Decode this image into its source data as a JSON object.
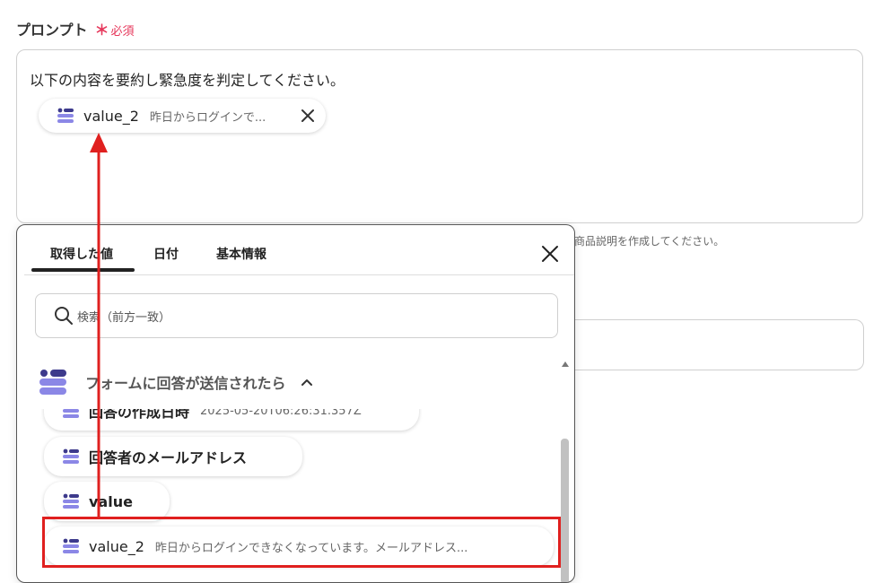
{
  "field": {
    "label": "プロンプト",
    "required_mark": "＊",
    "required_text": "必須"
  },
  "prompt": {
    "text": "以下の内容を要約し緊急度を判定してください。",
    "chip": {
      "name": "value_2",
      "value": "昨日からログインで..."
    }
  },
  "helper_text": "商品説明を作成してください。",
  "popup": {
    "tabs": [
      {
        "label": "取得した値",
        "active": true
      },
      {
        "label": "日付"
      },
      {
        "label": "基本情報"
      }
    ],
    "search": {
      "placeholder": "検索（前方一致）"
    },
    "group": {
      "title": "フォームに回答が送信されたら"
    },
    "items": [
      {
        "name": "回答の作成日時",
        "value": "2025-05-20T06:26:31.357Z"
      },
      {
        "name": "回答者のメールアドレス",
        "value": ""
      },
      {
        "name": "value",
        "value": ""
      },
      {
        "name": "value_2",
        "value": "昨日からログインできなくなっています。メールアドレス..."
      }
    ]
  },
  "colors": {
    "accent_red": "#e0201f",
    "required": "#e6365a",
    "icon_dark": "#3d3a8c",
    "icon_light": "#8b87e6"
  }
}
